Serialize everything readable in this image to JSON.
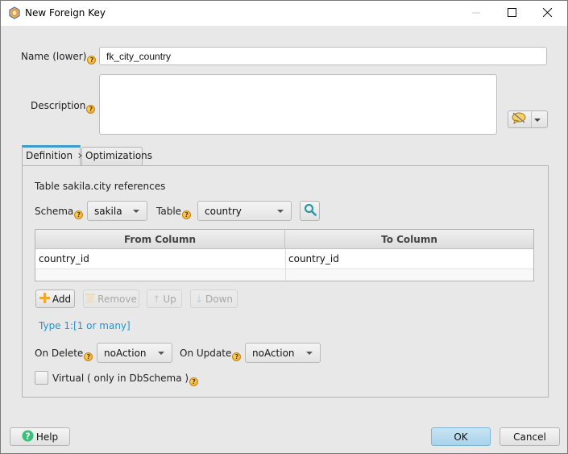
{
  "window": {
    "title": "New Foreign Key",
    "app_icon": "cube-icon",
    "controls": [
      "minimize",
      "maximize",
      "close"
    ]
  },
  "form": {
    "name_label": "Name (lower)",
    "name_value": "fk_city_country",
    "description_label": "Description",
    "description_value": "",
    "comment_button_icon": "comment-disabled-icon",
    "help_glyph": "?"
  },
  "tabs": [
    {
      "label": "Definition",
      "active": true,
      "closable": true,
      "close_glyph": "✕"
    },
    {
      "label": "Optimizations",
      "active": false
    }
  ],
  "definition": {
    "references_text": "Table sakila.city references",
    "schema_label": "Schema",
    "schema_value": "sakila",
    "table_label": "Table",
    "table_value": "country",
    "search_icon": "search-icon",
    "columns_table": {
      "headers": [
        "From Column",
        "To Column"
      ],
      "rows": [
        [
          "country_id",
          "country_id"
        ],
        [
          "",
          ""
        ]
      ]
    },
    "buttons": {
      "add": "Add",
      "remove": "Remove",
      "up": "Up",
      "down": "Down"
    },
    "type_link": "Type 1:[1 or many]",
    "on_delete_label": "On Delete",
    "on_delete_value": "noAction",
    "on_update_label": "On Update",
    "on_update_value": "noAction",
    "virtual_label": "Virtual ( only in DbSchema )",
    "virtual_checked": false
  },
  "footer": {
    "help": "Help",
    "ok": "OK",
    "cancel": "Cancel"
  },
  "colors": {
    "accent": "#3e9ad3",
    "link": "#2a93c9",
    "ok_button": "#a9d3ec",
    "help_icon": "#3cbf7a"
  }
}
